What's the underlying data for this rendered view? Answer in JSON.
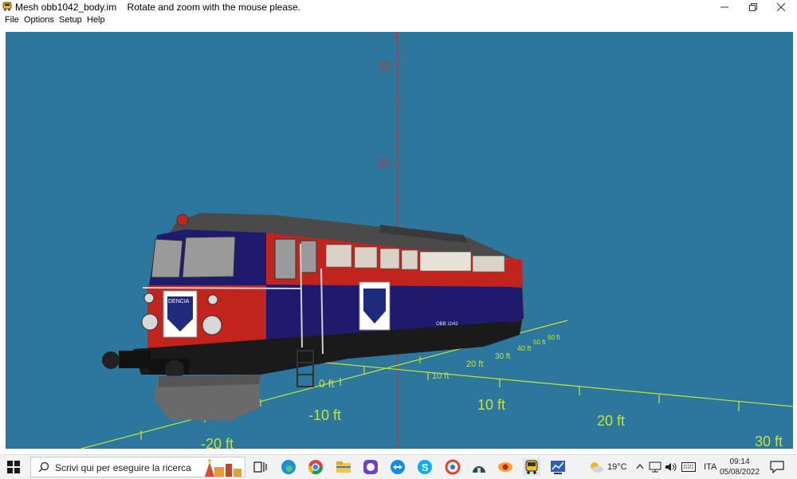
{
  "window": {
    "title": "Mesh obb1042_body.im",
    "hint": "Rotate and zoom with the mouse please."
  },
  "menu": [
    "File",
    "Options",
    "Setup",
    "Help"
  ],
  "viewport": {
    "background": "#2b789c",
    "z_axis_label": "z",
    "z_ticks": [
      "30",
      "20"
    ],
    "floor_ticks_near": [
      "-10 ft",
      "10 ft",
      "20 ft",
      "30 ft",
      "-20 ft"
    ],
    "floor_ticks_far": [
      "10 ft",
      "20 ft",
      "30 ft",
      "40 ft",
      "50 ft",
      "60 ft",
      "0 ft"
    ],
    "model_plate": "OBB 1042"
  },
  "taskbar": {
    "search_placeholder": "Scrivi qui per eseguire la ricerca",
    "weather_temp": "19°C",
    "language": "ITA",
    "time": "09:14",
    "date": "05/08/2022"
  }
}
